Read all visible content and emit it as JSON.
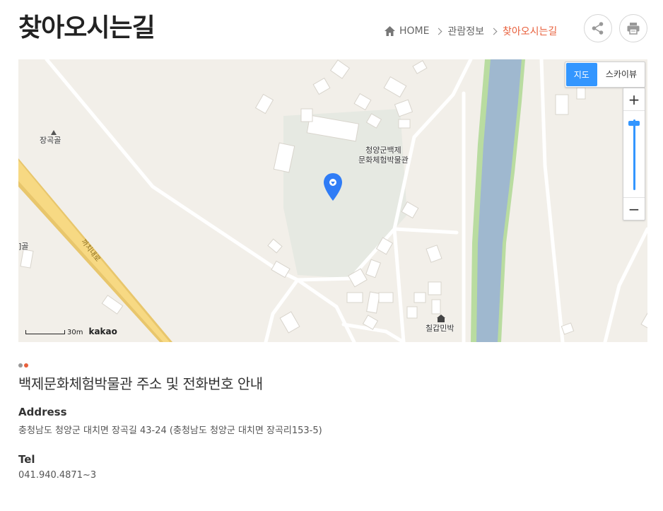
{
  "page": {
    "title": "찾아오시는길"
  },
  "breadcrumb": {
    "home": "HOME",
    "level1": "관람정보",
    "current": "찾아오시는길"
  },
  "actions": {
    "share_icon": "share-icon",
    "print_icon": "print-icon"
  },
  "map": {
    "type_options": [
      "지도",
      "스카이뷰"
    ],
    "active_type": "지도",
    "zoom_in": "+",
    "zoom_out": "−",
    "scale": "30m",
    "logo": "kakao",
    "labels": {
      "place1": "장곡골",
      "museum_line1": "청양군백제",
      "museum_line2": "문화체험박물관",
      "left_edge": "]골",
      "road": "까치내로",
      "lodging": "칠갑민박"
    },
    "colors": {
      "land": "#f2efe9",
      "river": "#9fb8cf",
      "riverbank": "#b9dca0",
      "road": "#f7d983",
      "marker": "#2f7cf6"
    }
  },
  "info": {
    "dot_colors": [
      "#999999",
      "#e8603c"
    ],
    "heading": "백제문화체험박물관 주소 및 전화번호 안내",
    "address_label": "Address",
    "address": "충청남도 청양군 대치면 장곡길 43-24 (충청남도 청양군 대치면 장곡리153-5)",
    "tel_label": "Tel",
    "tel": "041.940.4871~3"
  },
  "colors": {
    "accent": "#e8603c",
    "map_button_active": "#3396ff"
  }
}
